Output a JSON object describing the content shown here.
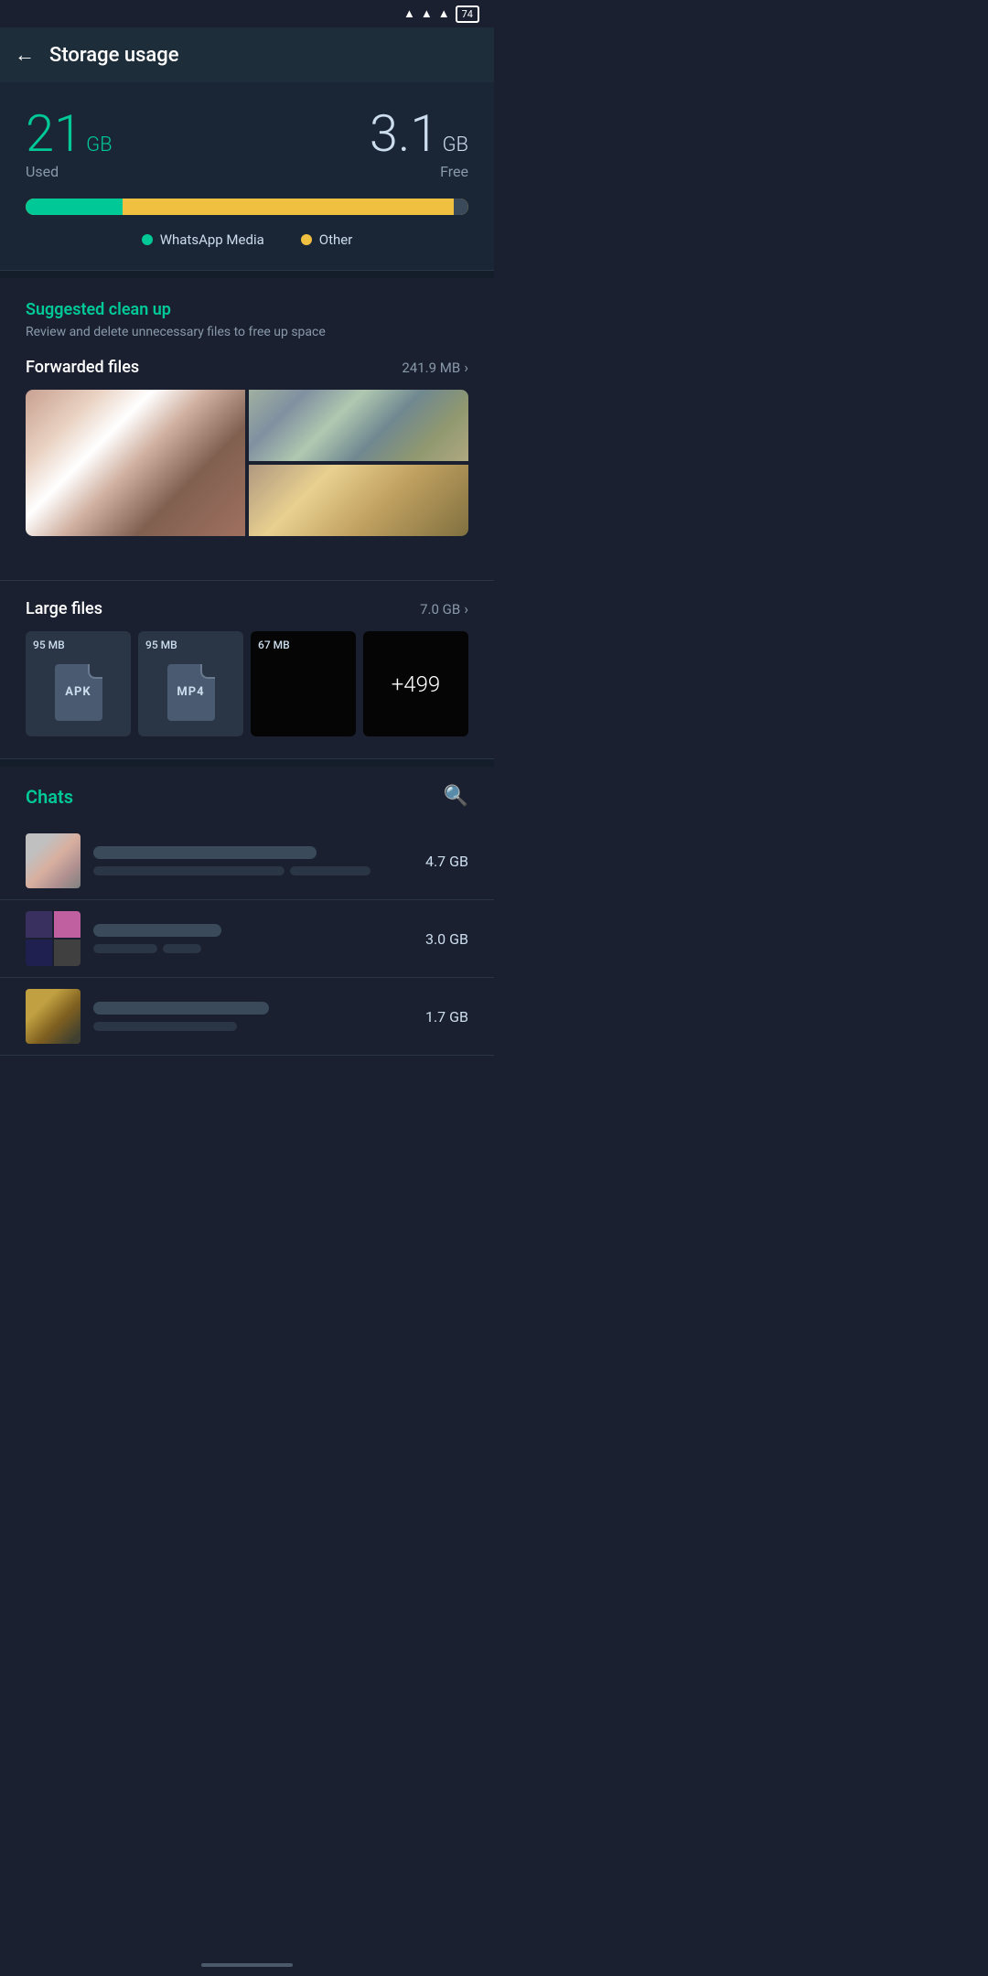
{
  "statusBar": {
    "battery": "74",
    "wifi": "wifi",
    "signal1": "signal",
    "signal2": "signal"
  },
  "appBar": {
    "title": "Storage usage",
    "backLabel": "←"
  },
  "storage": {
    "usedNumber": "21",
    "usedUnit": "GB",
    "usedLabel": "Used",
    "freeNumber": "3.1",
    "freeUnit": "GB",
    "freeLabel": "Free",
    "barUsedPercent": 22,
    "legend": {
      "item1Label": "WhatsApp Media",
      "item2Label": "Other"
    }
  },
  "suggestedCleanup": {
    "title": "Suggested clean up",
    "description": "Review and delete unnecessary files to free up space",
    "forwardedFiles": {
      "label": "Forwarded files",
      "size": "241.9 MB"
    },
    "largeFiles": {
      "label": "Large files",
      "size": "7.0 GB",
      "files": [
        {
          "size": "95 MB",
          "type": "APK"
        },
        {
          "size": "95 MB",
          "type": "MP4"
        },
        {
          "size": "67 MB",
          "type": "video"
        },
        {
          "size": "+499",
          "type": "more"
        }
      ]
    }
  },
  "chats": {
    "title": "Chats",
    "searchIconLabel": "search",
    "items": [
      {
        "size": "4.7 GB"
      },
      {
        "size": "3.0 GB"
      },
      {
        "size": "1.7 GB"
      }
    ]
  }
}
